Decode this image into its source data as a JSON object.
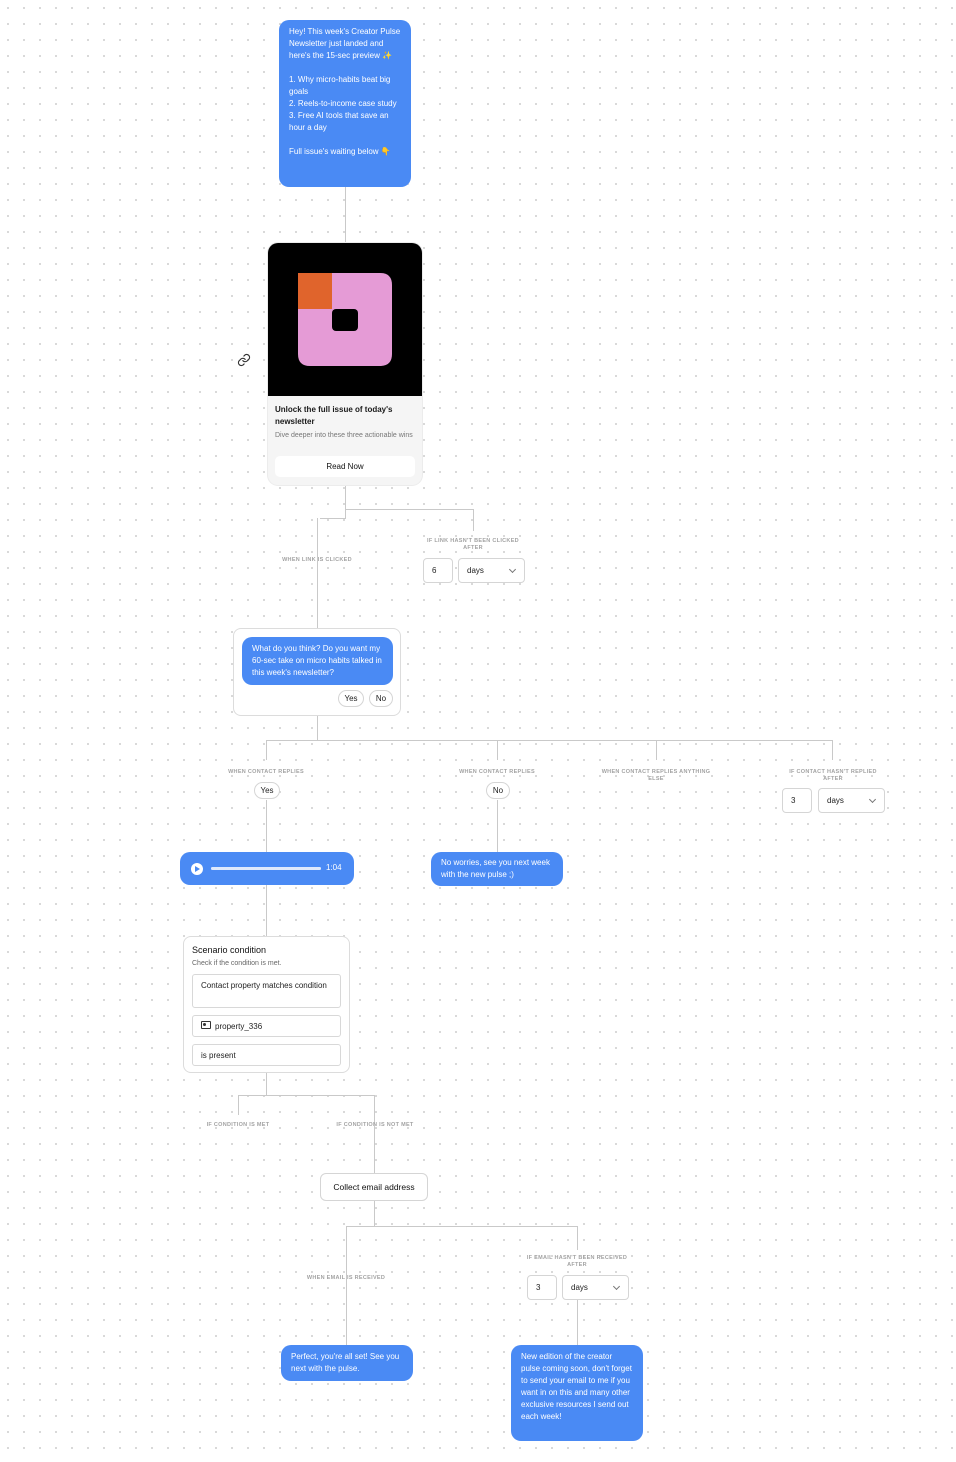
{
  "intro_message": {
    "text": "Hey! This week's Creator Pulse Newsletter just landed and here's the 15-sec preview ✨\n\n1. Why micro-habits beat big goals\n2. Reels-to-income case study\n3. Free AI tools that save an hour a day\n\nFull issue's waiting below 👇"
  },
  "link_card": {
    "title": "Unlock the full issue of today's newsletter",
    "subtitle": "Dive deeper into these three actionable wins",
    "button_label": "Read Now",
    "link_icon": "link-icon",
    "logo_colors": {
      "orange": "#e0642c",
      "pink": "#e59bd6",
      "background": "#000000"
    }
  },
  "link_branches": {
    "clicked_label": "WHEN LINK IS CLICKED",
    "not_clicked_label": "IF LINK HASN'T BEEN CLICKED AFTER",
    "delay_value": "6",
    "delay_unit": "days"
  },
  "question_card": {
    "text": "What do you think? Do you want my 60-sec take on micro habits talked in this week's newsletter?",
    "yes_label": "Yes",
    "no_label": "No"
  },
  "reply_branches": {
    "yes_label": "WHEN CONTACT REPLIES",
    "yes_value": "Yes",
    "no_label": "WHEN CONTACT REPLIES",
    "no_value": "No",
    "else_label": "WHEN CONTACT REPLIES ANYTHING ELSE",
    "noreply_label": "IF CONTACT HASN'T REPLIED AFTER",
    "delay_value": "3",
    "delay_unit": "days"
  },
  "audio_message": {
    "duration": "1:04",
    "progress": 1.0
  },
  "no_reply_message": {
    "text": "No worries, see you next week with the new pulse ;)"
  },
  "scenario_condition": {
    "title": "Scenario condition",
    "subtitle": "Check if the condition is met.",
    "condition_type": "Contact property matches condition",
    "property": "property_336",
    "operator": "is present"
  },
  "condition_branches": {
    "met_label": "IF CONDITION IS MET",
    "not_met_label": "IF CONDITION IS NOT MET"
  },
  "collect_email": {
    "label": "Collect email address"
  },
  "email_branches": {
    "received_label": "WHEN EMAIL IS RECEIVED",
    "not_received_label": "IF EMAIL HASN'T BEEN RECEIVED AFTER",
    "delay_value": "3",
    "delay_unit": "days"
  },
  "email_received_message": {
    "text": "Perfect, you're all set! See you next with the pulse."
  },
  "email_reminder_message": {
    "text": "New edition of the creator pulse coming soon, don't forget to send your email to me if you want in on this and many other exclusive resources I send out each week!"
  }
}
